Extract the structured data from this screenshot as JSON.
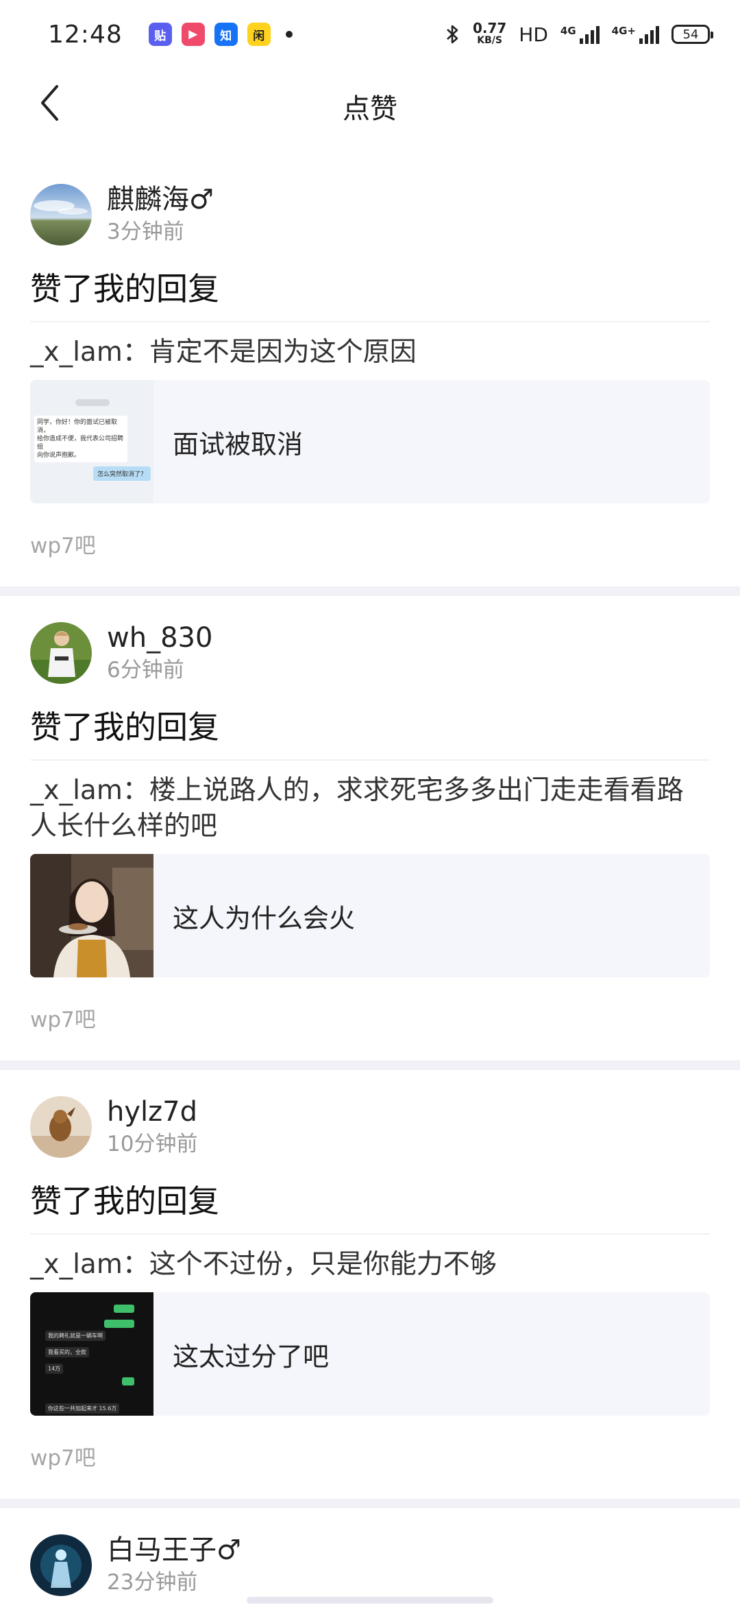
{
  "status_bar": {
    "time": "12:48",
    "apps": [
      {
        "name": "tieba-app-icon",
        "label": "贴",
        "color": "#5b5fef"
      },
      {
        "name": "video-app-icon",
        "label": "▶",
        "color": "#f04a6b"
      },
      {
        "name": "zhihu-app-icon",
        "label": "知",
        "color": "#1772f6"
      },
      {
        "name": "xianyu-app-icon",
        "label": "闲",
        "color": "#ffd21f"
      }
    ],
    "net_speed": "0.77",
    "net_unit": "KB/S",
    "hd_label": "HD",
    "signal_1_label": "4G",
    "signal_2_label": "4G+",
    "battery": "54"
  },
  "nav": {
    "title": "点赞"
  },
  "notifications": [
    {
      "username": "麒麟海♂",
      "time": "3分钟前",
      "action": "赞了我的回复",
      "reply_user": "_x_lam",
      "reply_text": "_x_lam：肯定不是因为这个原因",
      "post_title": "面试被取消",
      "forum": "wp7吧",
      "thumb_lines": [
        "同学，你好！你的面试已被取消，",
        "给你造成不便，我代表公司招聘组",
        "向你说声抱歉。"
      ],
      "thumb_reply": "怎么突然取消了？"
    },
    {
      "username": "wh_830",
      "time": "6分钟前",
      "action": "赞了我的回复",
      "reply_text": "_x_lam：楼上说路人的，求求死宅多多出门走走看看路人长什么样的吧",
      "post_title": "这人为什么会火",
      "forum": "wp7吧"
    },
    {
      "username": "hylz7d",
      "time": "10分钟前",
      "action": "赞了我的回复",
      "reply_text": "_x_lam：这个不过份，只是你能力不够",
      "post_title": "这太过分了吧",
      "forum": "wp7吧",
      "thumb_chat": [
        "我的聘礼就是一辆车啊",
        "我看买的，全款",
        "14万",
        "你这些一共加起来才 15.6万"
      ]
    },
    {
      "username": "白马王子♂",
      "time": "23分钟前"
    }
  ]
}
